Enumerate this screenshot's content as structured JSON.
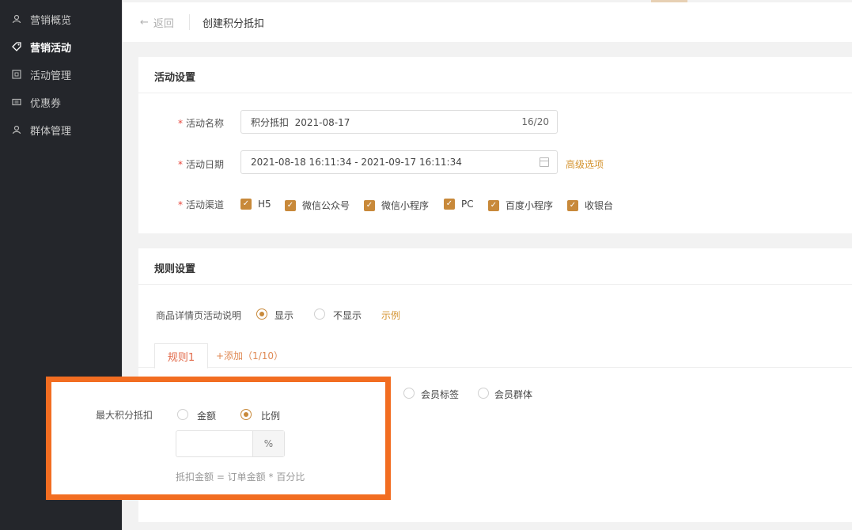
{
  "sidebar": {
    "items": [
      {
        "label": "营销概览",
        "icon": "user-icon",
        "active": false
      },
      {
        "label": "营销活动",
        "icon": "tag-icon",
        "active": true
      },
      {
        "label": "活动管理",
        "icon": "grid-icon",
        "active": false
      },
      {
        "label": "优惠券",
        "icon": "ticket-icon",
        "active": false
      },
      {
        "label": "群体管理",
        "icon": "user-icon",
        "active": false
      }
    ]
  },
  "header": {
    "back_label": "返回",
    "title": "创建积分抵扣"
  },
  "activity_settings": {
    "title": "活动设置",
    "name_label": "活动名称",
    "name_value": "积分抵扣  2021-08-17",
    "name_counter": "16/20",
    "date_label": "活动日期",
    "date_value": "2021-08-18 16:11:34 - 2021-09-17 16:11:34",
    "advanced_label": "高级选项",
    "channel_label": "活动渠道",
    "channels": [
      {
        "label": "H5",
        "checked": true
      },
      {
        "label": "微信公众号",
        "checked": true
      },
      {
        "label": "微信小程序",
        "checked": true
      },
      {
        "label": "PC",
        "checked": true
      },
      {
        "label": "百度小程序",
        "checked": true
      },
      {
        "label": "收银台",
        "checked": true
      }
    ]
  },
  "rule_settings": {
    "title": "规则设置",
    "desc_label": "商品详情页活动说明",
    "desc_options": [
      {
        "label": "显示",
        "selected": true
      },
      {
        "label": "不显示",
        "selected": false
      }
    ],
    "example_label": "示例",
    "tab_label": "规则1",
    "add_label": "+添加（1/10）",
    "audience_options": [
      {
        "label": "会员标签",
        "selected": false
      },
      {
        "label": "会员群体",
        "selected": false
      }
    ]
  },
  "max_deduct": {
    "label": "最大积分抵扣",
    "options": [
      {
        "label": "金额",
        "selected": false
      },
      {
        "label": "比例",
        "selected": true
      }
    ],
    "input_value": "",
    "suffix": "%",
    "hint": "抵扣金额 = 订单金额 * 百分比"
  },
  "colors": {
    "accent": "#c8893a",
    "highlight_border": "#f26d21",
    "required": "#e8463b",
    "sidebar_bg": "#24262b"
  }
}
